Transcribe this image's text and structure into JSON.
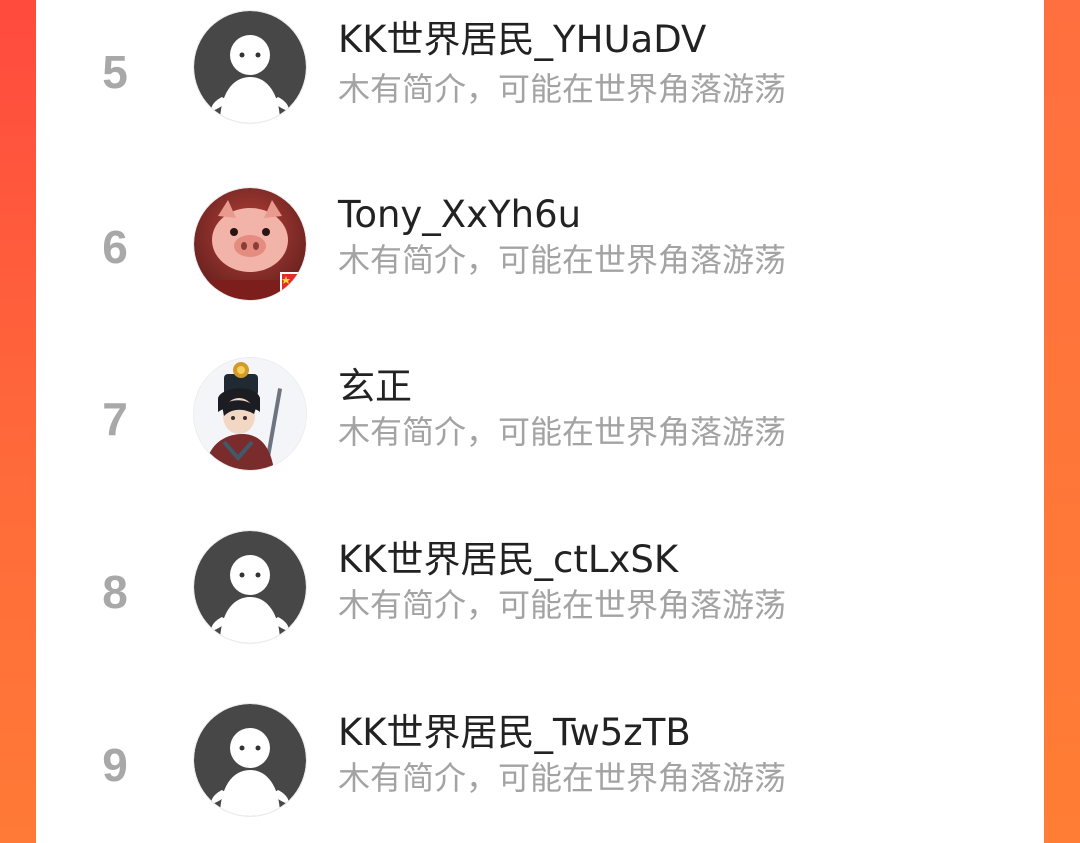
{
  "ranking_list": {
    "items": [
      {
        "rank": "5",
        "name": "KK世界居民_YHUaDV",
        "bio": "木有简介，可能在世界角落游荡",
        "avatar": "default-avatar-icon"
      },
      {
        "rank": "6",
        "name": "Tony_XxYh6u",
        "bio": "木有简介，可能在世界角落游荡",
        "avatar": "pig-avatar-icon"
      },
      {
        "rank": "7",
        "name": "玄正",
        "bio": "木有简介，可能在世界角落游荡",
        "avatar": "character-avatar-icon"
      },
      {
        "rank": "8",
        "name": "KK世界居民_ctLxSK",
        "bio": "木有简介，可能在世界角落游荡",
        "avatar": "default-avatar-icon"
      },
      {
        "rank": "9",
        "name": "KK世界居民_Tw5zTB",
        "bio": "木有简介，可能在世界角落游荡",
        "avatar": "default-avatar-icon"
      }
    ]
  },
  "colors": {
    "background_gradient_top": "#ff4a3e",
    "background_gradient_bottom": "#ff7a36",
    "panel": "#ffffff",
    "rank_text": "#a8a8a8",
    "name_text": "#222222",
    "bio_text": "#a3a3a3"
  }
}
